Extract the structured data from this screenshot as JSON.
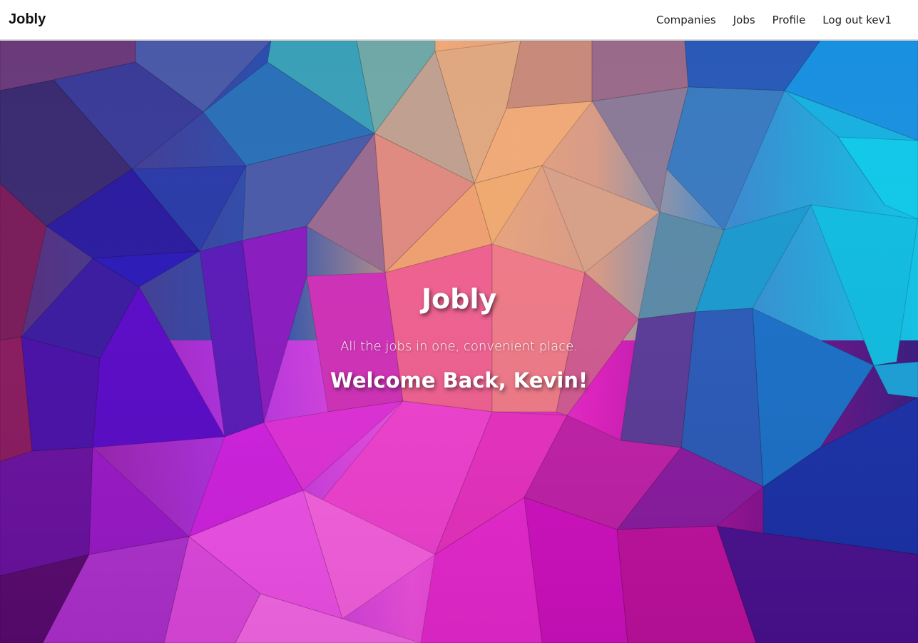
{
  "navbar": {
    "brand": "Jobly",
    "links": {
      "companies": "Companies",
      "jobs": "Jobs",
      "profile": "Profile",
      "logout": "Log out kev1"
    }
  },
  "hero": {
    "title": "Jobly",
    "tagline": "All the jobs in one, convenient place.",
    "welcome": "Welcome Back, Kevin!",
    "background_style": "low-poly gradient",
    "colors": [
      "#1e90e0",
      "#10c4e6",
      "#f0a070",
      "#e040d0",
      "#6a10d0",
      "#c010b0",
      "#3a2a90"
    ]
  }
}
